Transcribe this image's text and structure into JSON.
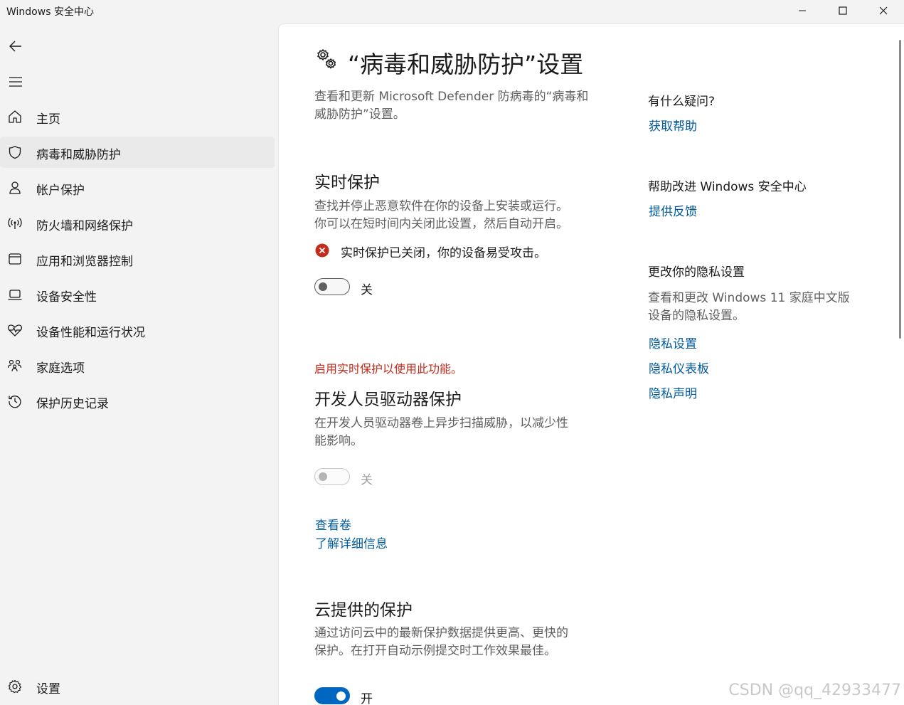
{
  "window": {
    "title": "Windows 安全中心"
  },
  "sidebar": {
    "items": [
      {
        "label": "主页",
        "icon": "home-icon"
      },
      {
        "label": "病毒和威胁防护",
        "icon": "shield-icon",
        "selected": true
      },
      {
        "label": "帐户保护",
        "icon": "person-icon"
      },
      {
        "label": "防火墙和网络保护",
        "icon": "wireless-icon"
      },
      {
        "label": "应用和浏览器控制",
        "icon": "app-window-icon"
      },
      {
        "label": "设备安全性",
        "icon": "laptop-icon"
      },
      {
        "label": "设备性能和运行状况",
        "icon": "heart-pulse-icon"
      },
      {
        "label": "家庭选项",
        "icon": "family-icon"
      },
      {
        "label": "保护历史记录",
        "icon": "history-icon"
      }
    ],
    "settings_label": "设置"
  },
  "main": {
    "title": "“病毒和威胁防护”设置",
    "intro_line1": "查看和更新 Microsoft Defender 防病毒的“病毒和",
    "intro_line2": "威胁防护”设置。",
    "realtime": {
      "heading": "实时保护",
      "desc_line1": "查找并停止恶意软件在你的设备上安装或运行。",
      "desc_line2": "你可以在短时间内关闭此设置，然后自动开启。",
      "warning": "实时保护已关闭，你的设备易受攻击。",
      "toggle_label": "关",
      "toggle_on": false
    },
    "dev_drive": {
      "notice": "启用实时保护以使用此功能。",
      "heading": "开发人员驱动器保护",
      "desc_line1": "在开发人员驱动器卷上异步扫描威胁，以减少性",
      "desc_line2": "能影响。",
      "toggle_label": "关",
      "toggle_on": false,
      "link_volumes": "查看卷",
      "link_learn": "了解详细信息"
    },
    "cloud": {
      "heading": "云提供的保护",
      "desc_line1": "通过访问云中的最新保护数据提供更高、更快的",
      "desc_line2": "保护。在打开自动示例提交时工作效果最佳。",
      "toggle_label": "开",
      "toggle_on": true
    }
  },
  "aside": {
    "question": "有什么疑问?",
    "get_help": "获取帮助",
    "improve_heading": "帮助改进 Windows 安全中心",
    "feedback": "提供反馈",
    "privacy_heading": "更改你的隐私设置",
    "privacy_desc_line1": "查看和更改 Windows 11 家庭中文版",
    "privacy_desc_line2": "设备的隐私设置。",
    "privacy_settings": "隐私设置",
    "privacy_dashboard": "隐私仪表板",
    "privacy_statement": "隐私声明"
  },
  "watermark": "CSDN @qq_42933477",
  "colors": {
    "accent": "#0067c0",
    "link": "#005a9e",
    "error": "#c42b1c"
  }
}
